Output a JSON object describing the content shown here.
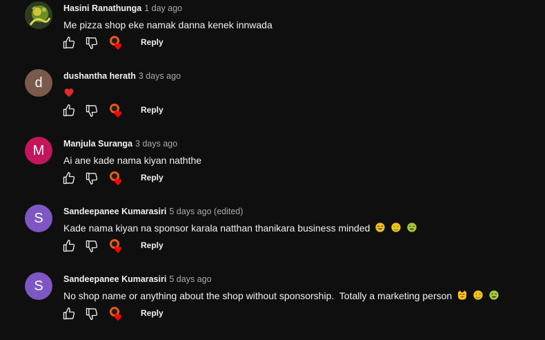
{
  "comments": [
    {
      "author": "Hasini Ranathunga",
      "time": "1 day ago",
      "edited": "",
      "text": "Me pizza shop eke namak danna kenek innwada",
      "avatar_letter": "",
      "avatar_color": "#3c5a2a",
      "reply_label": "Reply"
    },
    {
      "author": "dushantha herath",
      "time": "3 days ago",
      "edited": "",
      "text": "",
      "avatar_letter": "d",
      "avatar_color": "#7a5a4b",
      "reply_label": "Reply"
    },
    {
      "author": "Manjula Suranga",
      "time": "3 days ago",
      "edited": "",
      "text": "Ai ane kade nama kiyan naththe",
      "avatar_letter": "M",
      "avatar_color": "#c2185b",
      "reply_label": "Reply"
    },
    {
      "author": "Sandeepanee Kumarasiri",
      "time": "5 days ago",
      "edited": "(edited)",
      "text": "Kade nama kiyan na sponsor karala natthan thanikara business minded",
      "avatar_letter": "S",
      "avatar_color": "#7e57c2",
      "reply_label": "Reply"
    },
    {
      "author": "Sandeepanee Kumarasiri",
      "time": "5 days ago",
      "edited": "",
      "text": "No shop name or anything about the shop without sponsorship.  Totally a marketing person",
      "avatar_letter": "S",
      "avatar_color": "#7e57c2",
      "reply_label": "Reply"
    }
  ],
  "icons": {
    "like": "thumbs-up-icon",
    "dislike": "thumbs-down-icon",
    "creator_heart": "creator-heart-icon",
    "emoji_heart": "red-heart-emoji",
    "emoji_joy": "tears-of-joy-emoji",
    "emoji_money": "money-mouth-emoji",
    "emoji_nauseated": "nauseated-face-emoji",
    "emoji_cat": "grinning-cat-emoji"
  }
}
